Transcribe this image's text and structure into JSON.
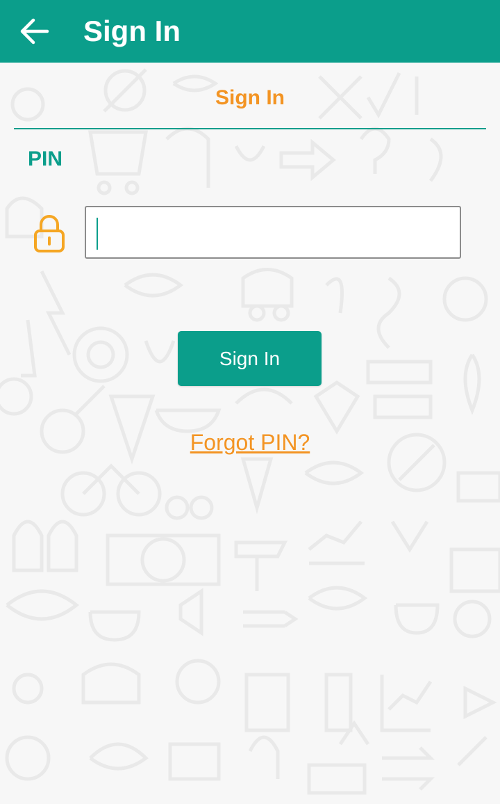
{
  "app_bar": {
    "title": "Sign In",
    "back_icon": "arrow-back-icon"
  },
  "tab": {
    "title": "Sign In"
  },
  "form": {
    "pin_label": "PIN",
    "lock_icon": "lock-icon",
    "pin_value": "",
    "pin_placeholder": ""
  },
  "actions": {
    "sign_in_label": "Sign In",
    "forgot_label": "Forgot PIN?"
  },
  "colors": {
    "primary": "#0b9e8b",
    "accent": "#f39423",
    "background": "#f7f7f7"
  }
}
